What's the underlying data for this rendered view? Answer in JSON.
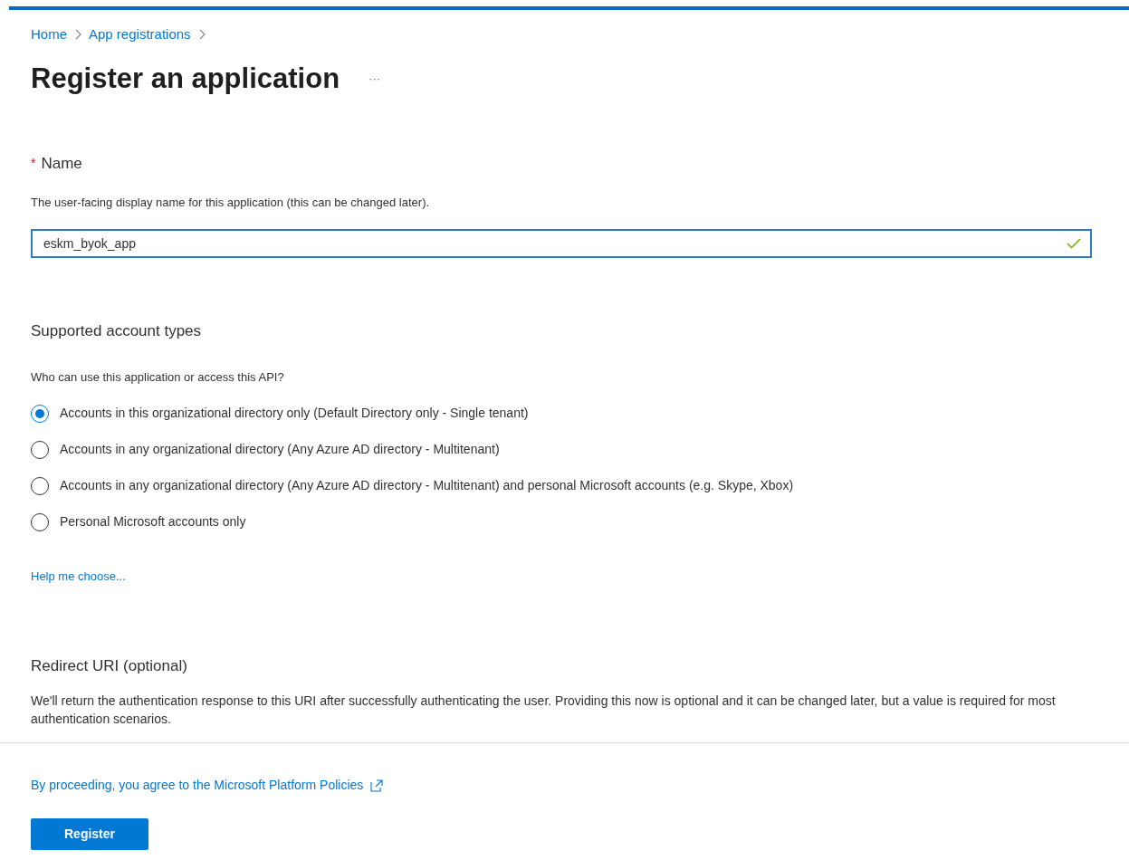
{
  "breadcrumb": [
    {
      "label": "Home"
    },
    {
      "label": "App registrations"
    }
  ],
  "title": "Register an application",
  "more": "···",
  "name_field": {
    "required_mark": "*",
    "label": "Name",
    "description": "The user-facing display name for this application (this can be changed later).",
    "value": "eskm_byok_app",
    "valid": true
  },
  "account_types": {
    "heading": "Supported account types",
    "question": "Who can use this application or access this API?",
    "options": [
      {
        "label": "Accounts in this organizational directory only (Default Directory only - Single tenant)",
        "selected": true
      },
      {
        "label": "Accounts in any organizational directory (Any Azure AD directory - Multitenant)",
        "selected": false
      },
      {
        "label": "Accounts in any organizational directory (Any Azure AD directory - Multitenant) and personal Microsoft accounts (e.g. Skype, Xbox)",
        "selected": false
      },
      {
        "label": "Personal Microsoft accounts only",
        "selected": false
      }
    ],
    "help_link": "Help me choose..."
  },
  "redirect": {
    "heading": "Redirect URI (optional)",
    "description": "We'll return the authentication response to this URI after successfully authenticating the user. Providing this now is optional and it can be changed later, but a value is required for most authentication scenarios."
  },
  "footer": {
    "policy_link": "By proceeding, you agree to the Microsoft Platform Policies",
    "button": "Register"
  }
}
